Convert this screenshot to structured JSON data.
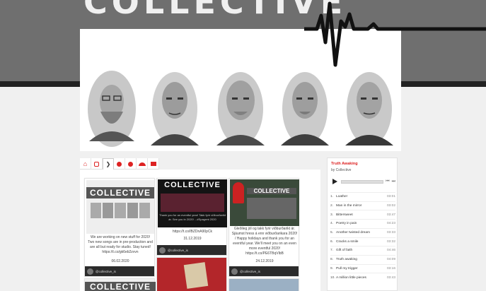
{
  "nav": {
    "tabs": [
      {
        "icon": "home-icon"
      },
      {
        "icon": "instagram-icon"
      },
      {
        "icon": "twitter-icon"
      },
      {
        "icon": "facebook-icon"
      },
      {
        "icon": "spotify-icon"
      },
      {
        "icon": "soundcloud-icon"
      },
      {
        "icon": "video-icon"
      }
    ]
  },
  "banner": {
    "logo_text": "COLLECTIVE"
  },
  "feed": {
    "posts": [
      {
        "image_title": "COLLECTIVE",
        "text": "We are working on new stuff for 2020! Two new songs are in pre-production and are all but ready for studio. Stay tuned! https://t.co/gk6eb2zvvn",
        "date": "06.02.2020",
        "handle": "@collective_is"
      },
      {
        "image_title": "COLLECTIVE",
        "image_caption": "Thank you for an eventful year! Takk fyrir viðburðarikt ár. See you in 2020! ...#Spagrmt 2020",
        "link": "https://t.co/lBZDnA90pCk",
        "date": "31.12.2019",
        "handle": "@collective_is"
      },
      {
        "image_title": "COLLECTIVE",
        "text": "Gleðileg jól og takk fyrir viðburðarikt ár. Sjáumst hress á enn viðburðarikara 2020! / Happy holidays and thank you for an eventful year. We'll meet you on an even more eventful 2020! https://t.co/PE6TBqVlbB",
        "date": "24.12.2019",
        "handle": "@collective_is"
      }
    ],
    "more_title": "COLLECTIVE"
  },
  "player": {
    "album": "Truth Awaking",
    "by": "by Collective",
    "tracks": [
      {
        "n": "1.",
        "name": "Loathe!",
        "dur": "03:01"
      },
      {
        "n": "2.",
        "name": "Man in the mirror",
        "dur": "03:02"
      },
      {
        "n": "3.",
        "name": "Bittersweet",
        "dur": "03:47"
      },
      {
        "n": "4.",
        "name": "Poetry in pain",
        "dur": "04:23"
      },
      {
        "n": "5.",
        "name": "Another twisted dream",
        "dur": "03:33"
      },
      {
        "n": "6.",
        "name": "Cracks a smile",
        "dur": "03:32"
      },
      {
        "n": "7.",
        "name": "Gift of faith",
        "dur": "04:46"
      },
      {
        "n": "8.",
        "name": "Truth awaking",
        "dur": "04:09"
      },
      {
        "n": "9.",
        "name": "Pull my trigger",
        "dur": "03:16"
      },
      {
        "n": "10.",
        "name": "A million little pieces",
        "dur": "03:43"
      }
    ]
  },
  "colors": {
    "accent": "#dd2222",
    "banner": "#6f6f6f",
    "dark": "#222222"
  }
}
